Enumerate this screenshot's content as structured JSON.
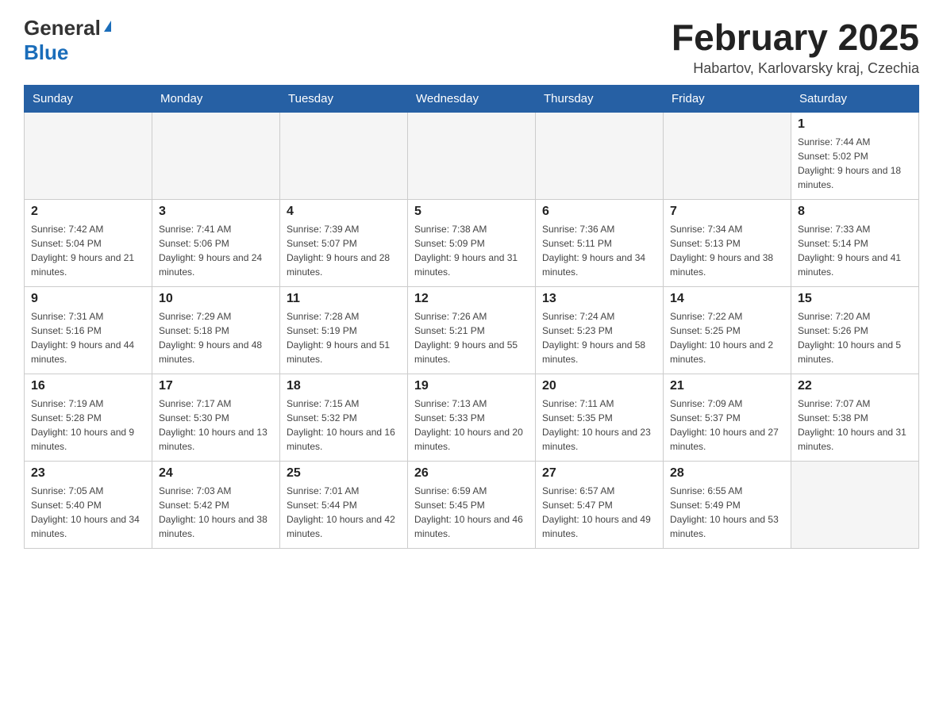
{
  "header": {
    "logo_general": "General",
    "logo_blue": "Blue",
    "month_year": "February 2025",
    "location": "Habartov, Karlovarsky kraj, Czechia"
  },
  "days_of_week": [
    "Sunday",
    "Monday",
    "Tuesday",
    "Wednesday",
    "Thursday",
    "Friday",
    "Saturday"
  ],
  "weeks": [
    [
      {
        "day": "",
        "info": ""
      },
      {
        "day": "",
        "info": ""
      },
      {
        "day": "",
        "info": ""
      },
      {
        "day": "",
        "info": ""
      },
      {
        "day": "",
        "info": ""
      },
      {
        "day": "",
        "info": ""
      },
      {
        "day": "1",
        "info": "Sunrise: 7:44 AM\nSunset: 5:02 PM\nDaylight: 9 hours and 18 minutes."
      }
    ],
    [
      {
        "day": "2",
        "info": "Sunrise: 7:42 AM\nSunset: 5:04 PM\nDaylight: 9 hours and 21 minutes."
      },
      {
        "day": "3",
        "info": "Sunrise: 7:41 AM\nSunset: 5:06 PM\nDaylight: 9 hours and 24 minutes."
      },
      {
        "day": "4",
        "info": "Sunrise: 7:39 AM\nSunset: 5:07 PM\nDaylight: 9 hours and 28 minutes."
      },
      {
        "day": "5",
        "info": "Sunrise: 7:38 AM\nSunset: 5:09 PM\nDaylight: 9 hours and 31 minutes."
      },
      {
        "day": "6",
        "info": "Sunrise: 7:36 AM\nSunset: 5:11 PM\nDaylight: 9 hours and 34 minutes."
      },
      {
        "day": "7",
        "info": "Sunrise: 7:34 AM\nSunset: 5:13 PM\nDaylight: 9 hours and 38 minutes."
      },
      {
        "day": "8",
        "info": "Sunrise: 7:33 AM\nSunset: 5:14 PM\nDaylight: 9 hours and 41 minutes."
      }
    ],
    [
      {
        "day": "9",
        "info": "Sunrise: 7:31 AM\nSunset: 5:16 PM\nDaylight: 9 hours and 44 minutes."
      },
      {
        "day": "10",
        "info": "Sunrise: 7:29 AM\nSunset: 5:18 PM\nDaylight: 9 hours and 48 minutes."
      },
      {
        "day": "11",
        "info": "Sunrise: 7:28 AM\nSunset: 5:19 PM\nDaylight: 9 hours and 51 minutes."
      },
      {
        "day": "12",
        "info": "Sunrise: 7:26 AM\nSunset: 5:21 PM\nDaylight: 9 hours and 55 minutes."
      },
      {
        "day": "13",
        "info": "Sunrise: 7:24 AM\nSunset: 5:23 PM\nDaylight: 9 hours and 58 minutes."
      },
      {
        "day": "14",
        "info": "Sunrise: 7:22 AM\nSunset: 5:25 PM\nDaylight: 10 hours and 2 minutes."
      },
      {
        "day": "15",
        "info": "Sunrise: 7:20 AM\nSunset: 5:26 PM\nDaylight: 10 hours and 5 minutes."
      }
    ],
    [
      {
        "day": "16",
        "info": "Sunrise: 7:19 AM\nSunset: 5:28 PM\nDaylight: 10 hours and 9 minutes."
      },
      {
        "day": "17",
        "info": "Sunrise: 7:17 AM\nSunset: 5:30 PM\nDaylight: 10 hours and 13 minutes."
      },
      {
        "day": "18",
        "info": "Sunrise: 7:15 AM\nSunset: 5:32 PM\nDaylight: 10 hours and 16 minutes."
      },
      {
        "day": "19",
        "info": "Sunrise: 7:13 AM\nSunset: 5:33 PM\nDaylight: 10 hours and 20 minutes."
      },
      {
        "day": "20",
        "info": "Sunrise: 7:11 AM\nSunset: 5:35 PM\nDaylight: 10 hours and 23 minutes."
      },
      {
        "day": "21",
        "info": "Sunrise: 7:09 AM\nSunset: 5:37 PM\nDaylight: 10 hours and 27 minutes."
      },
      {
        "day": "22",
        "info": "Sunrise: 7:07 AM\nSunset: 5:38 PM\nDaylight: 10 hours and 31 minutes."
      }
    ],
    [
      {
        "day": "23",
        "info": "Sunrise: 7:05 AM\nSunset: 5:40 PM\nDaylight: 10 hours and 34 minutes."
      },
      {
        "day": "24",
        "info": "Sunrise: 7:03 AM\nSunset: 5:42 PM\nDaylight: 10 hours and 38 minutes."
      },
      {
        "day": "25",
        "info": "Sunrise: 7:01 AM\nSunset: 5:44 PM\nDaylight: 10 hours and 42 minutes."
      },
      {
        "day": "26",
        "info": "Sunrise: 6:59 AM\nSunset: 5:45 PM\nDaylight: 10 hours and 46 minutes."
      },
      {
        "day": "27",
        "info": "Sunrise: 6:57 AM\nSunset: 5:47 PM\nDaylight: 10 hours and 49 minutes."
      },
      {
        "day": "28",
        "info": "Sunrise: 6:55 AM\nSunset: 5:49 PM\nDaylight: 10 hours and 53 minutes."
      },
      {
        "day": "",
        "info": ""
      }
    ]
  ]
}
